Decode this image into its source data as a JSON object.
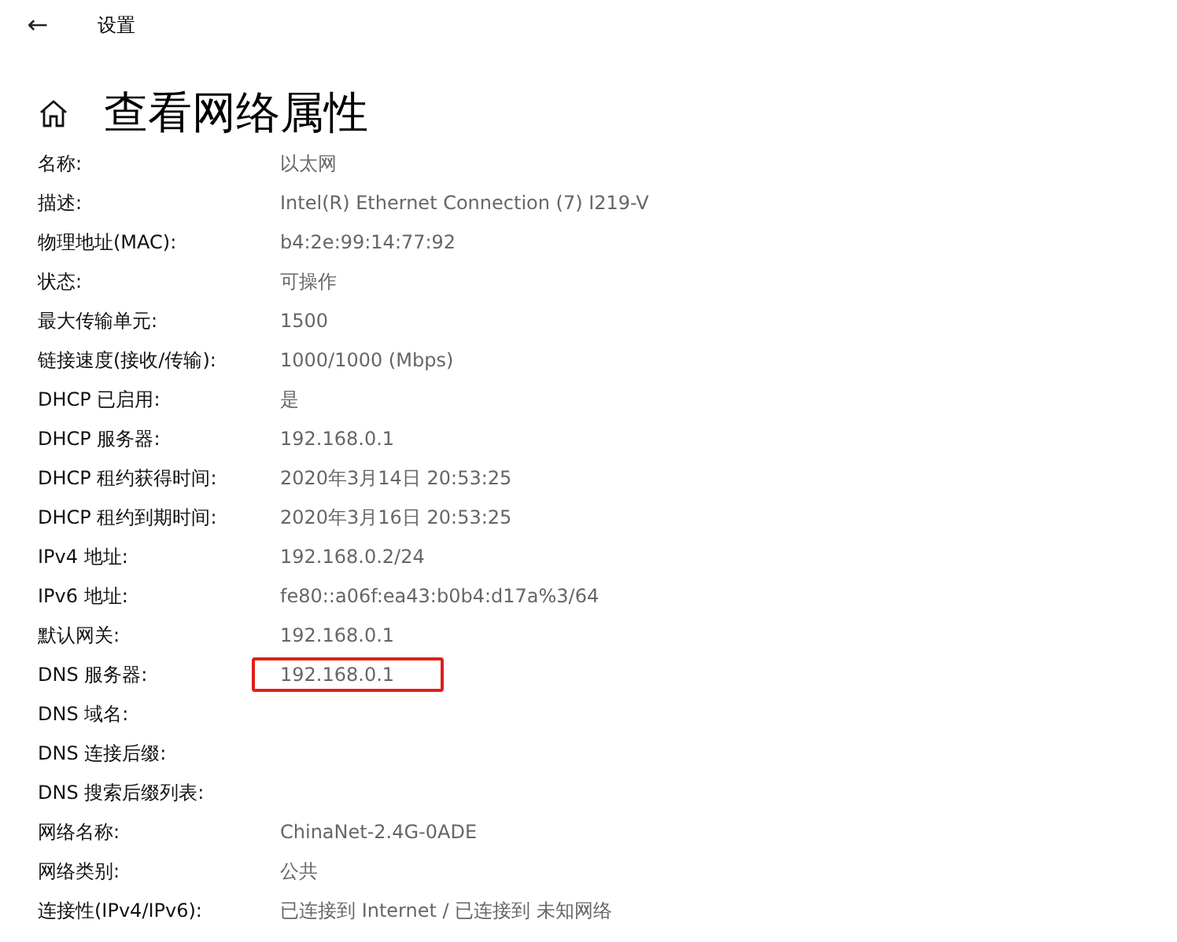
{
  "header": {
    "back": "←",
    "title": "设置"
  },
  "page": {
    "title": "查看网络属性"
  },
  "properties": [
    {
      "label": "名称:",
      "value": "以太网",
      "highlighted": false
    },
    {
      "label": "描述:",
      "value": "Intel(R) Ethernet Connection (7) I219-V",
      "highlighted": false
    },
    {
      "label": "物理地址(MAC):",
      "value": "b4:2e:99:14:77:92",
      "highlighted": false
    },
    {
      "label": "状态:",
      "value": "可操作",
      "highlighted": false
    },
    {
      "label": "最大传输单元:",
      "value": "1500",
      "highlighted": false
    },
    {
      "label": "链接速度(接收/传输):",
      "value": "1000/1000 (Mbps)",
      "highlighted": false
    },
    {
      "label": "DHCP 已启用:",
      "value": "是",
      "highlighted": false
    },
    {
      "label": "DHCP 服务器:",
      "value": "192.168.0.1",
      "highlighted": false
    },
    {
      "label": "DHCP 租约获得时间:",
      "value": "2020年3月14日 20:53:25",
      "highlighted": false
    },
    {
      "label": "DHCP 租约到期时间:",
      "value": "2020年3月16日 20:53:25",
      "highlighted": false
    },
    {
      "label": "IPv4 地址:",
      "value": "192.168.0.2/24",
      "highlighted": false
    },
    {
      "label": "IPv6 地址:",
      "value": "fe80::a06f:ea43:b0b4:d17a%3/64",
      "highlighted": false
    },
    {
      "label": "默认网关:",
      "value": "192.168.0.1",
      "highlighted": false
    },
    {
      "label": "DNS 服务器:",
      "value": "192.168.0.1",
      "highlighted": true
    },
    {
      "label": "DNS 域名:",
      "highlighted": false
    },
    {
      "label": "DNS 连接后缀:",
      "highlighted": false
    },
    {
      "label": "DNS 搜索后缀列表:",
      "highlighted": false
    },
    {
      "label": "网络名称:",
      "value": "ChinaNet-2.4G-0ADE",
      "highlighted": false
    },
    {
      "label": "网络类别:",
      "value": "公共",
      "highlighted": false
    },
    {
      "label": "连接性(IPv4/IPv6):",
      "value": "已连接到 Internet / 已连接到 未知网络",
      "highlighted": false
    }
  ]
}
